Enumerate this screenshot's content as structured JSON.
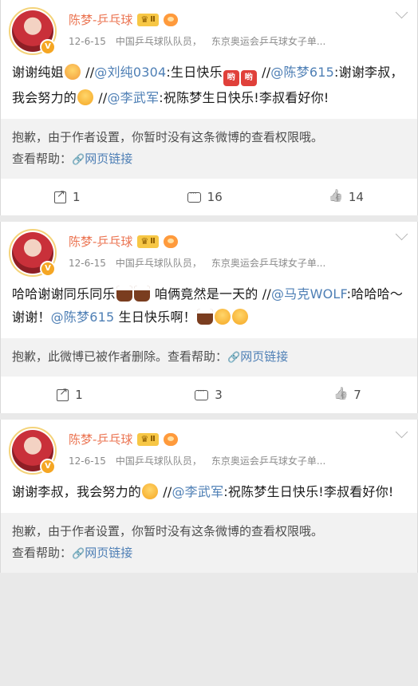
{
  "posts": [
    {
      "author": "陈梦-乒乓球",
      "level": "Ⅱ",
      "date": "12-6-15",
      "source1": "中国乒乓球队队员，",
      "source2": "东京奥运会乒乓球女子单...",
      "text": {
        "a": "谢谢纯姐",
        "b": " //",
        "m1": "@刘纯0304",
        "c": ":生日快乐",
        "d": " //",
        "m2": "@陈梦615",
        "e": ":谢谢李叔，我会努力的",
        "f": " //",
        "m3": "@李武军",
        "g": ":祝陈梦生日快乐!李叔看好你!"
      },
      "notice": "抱歉，由于作者设置，你暂时没有这条微博的查看权限哦。",
      "help": "查看帮助：",
      "link": "网页链接",
      "reposts": "1",
      "comments": "16",
      "likes": "14"
    },
    {
      "author": "陈梦-乒乓球",
      "level": "Ⅱ",
      "date": "12-6-15",
      "source1": "中国乒乓球队队员，",
      "source2": "东京奥运会乒乓球女子单...",
      "text": {
        "a": "哈哈谢谢同乐同乐",
        "b": " 咱俩竟然是一天的 //",
        "m1": "@马克WOLF",
        "c": ":哈哈哈～谢谢！",
        "m2": "@陈梦615",
        "d": " 生日快乐啊！"
      },
      "notice": "抱歉，此微博已被作者删除。查看帮助：",
      "link": "网页链接",
      "reposts": "1",
      "comments": "3",
      "likes": "7"
    },
    {
      "author": "陈梦-乒乓球",
      "level": "Ⅱ",
      "date": "12-6-15",
      "source1": "中国乒乓球队队员，",
      "source2": "东京奥运会乒乓球女子单...",
      "text": {
        "a": "谢谢李叔，我会努力的",
        "b": " //",
        "m1": "@李武军",
        "c": ":祝陈梦生日快乐!李叔看好你!"
      },
      "notice": "抱歉，由于作者设置，你暂时没有这条微博的查看权限哦。",
      "help": "查看帮助：",
      "link": "网页链接"
    }
  ],
  "icons": {
    "repost": "repost-icon",
    "comment": "comment-icon",
    "like": "like-icon",
    "link": "link-icon"
  },
  "colors": {
    "author_name": "#eb7350",
    "mention": "#4e7fb5",
    "notice_bg": "#f2f2f2"
  }
}
